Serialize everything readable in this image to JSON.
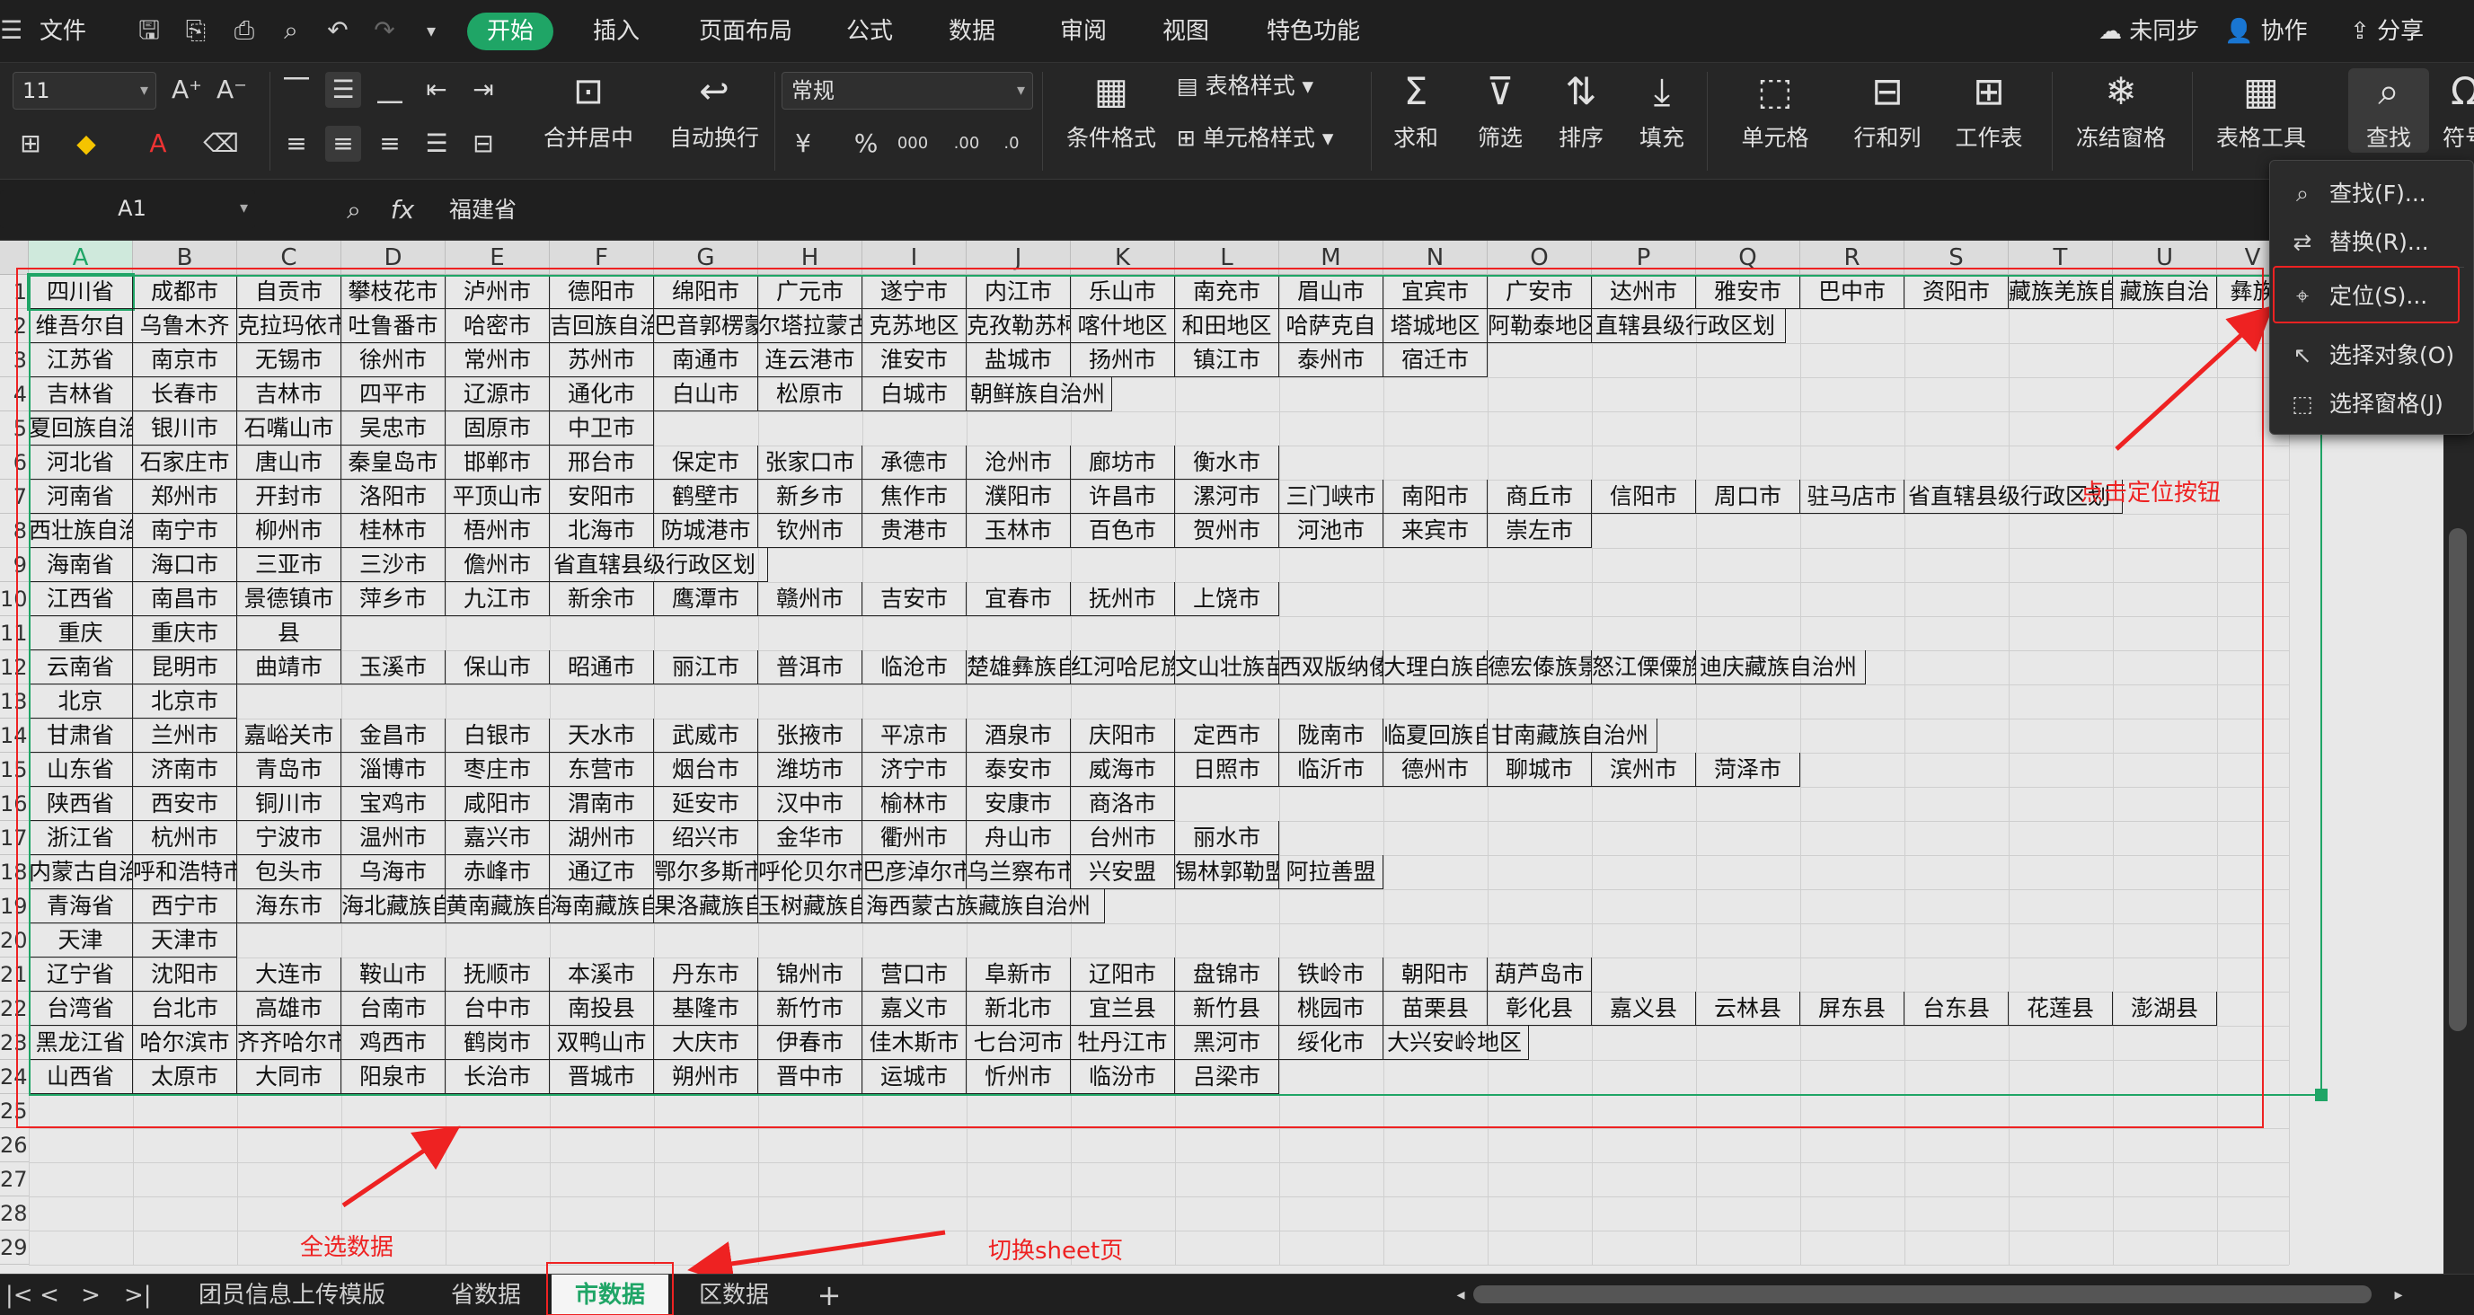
{
  "menubar": {
    "file": "文件",
    "tabs": [
      "开始",
      "插入",
      "页面布局",
      "公式",
      "数据",
      "审阅",
      "视图",
      "特色功能"
    ],
    "active_tab": "开始",
    "right": [
      "未同步",
      "协作",
      "分享"
    ]
  },
  "ribbon": {
    "font_size": "11",
    "number_format": "常规",
    "merge": "合并居中",
    "wrap": "自动换行",
    "cond_format": "条件格式",
    "table_style": "表格样式",
    "cell_style": "单元格样式",
    "sum": "求和",
    "filter": "筛选",
    "sort": "排序",
    "fill": "填充",
    "cell": "单元格",
    "rowcol": "行和列",
    "sheet": "工作表",
    "freeze": "冻结窗格",
    "table_tools": "表格工具",
    "find": "查找",
    "symbol": "符号"
  },
  "formula_bar": {
    "cell_ref": "A1",
    "fx": "fx",
    "value": "福建省"
  },
  "columns": [
    "A",
    "B",
    "C",
    "D",
    "E",
    "F",
    "G",
    "H",
    "I",
    "J",
    "K",
    "L",
    "M",
    "N",
    "O",
    "P",
    "Q",
    "R",
    "S",
    "T",
    "U",
    "V"
  ],
  "rows": [
    [
      "四川省",
      "成都市",
      "自贡市",
      "攀枝花市",
      "泸州市",
      "德阳市",
      "绵阳市",
      "广元市",
      "遂宁市",
      "内江市",
      "乐山市",
      "南充市",
      "眉山市",
      "宜宾市",
      "广安市",
      "达州市",
      "雅安市",
      "巴中市",
      "资阳市",
      "藏族羌族自",
      "藏族自治",
      "彝族"
    ],
    [
      "维吾尔自",
      "乌鲁木齐",
      "克拉玛依市",
      "吐鲁番市",
      "哈密市",
      "吉回族自治",
      "巴音郭楞蒙古自",
      "尔塔拉蒙古自",
      "克苏地区",
      "克孜勒苏柯尔克孜",
      "喀什地区",
      "和田地区",
      "哈萨克自",
      "塔城地区",
      "阿勒泰地区",
      "直辖县级行政区划"
    ],
    [
      "江苏省",
      "南京市",
      "无锡市",
      "徐州市",
      "常州市",
      "苏州市",
      "南通市",
      "连云港市",
      "淮安市",
      "盐城市",
      "扬州市",
      "镇江市",
      "泰州市",
      "宿迁市"
    ],
    [
      "吉林省",
      "长春市",
      "吉林市",
      "四平市",
      "辽源市",
      "通化市",
      "白山市",
      "松原市",
      "白城市",
      "朝鲜族自治州"
    ],
    [
      "夏回族自治",
      "银川市",
      "石嘴山市",
      "吴忠市",
      "固原市",
      "中卫市"
    ],
    [
      "河北省",
      "石家庄市",
      "唐山市",
      "秦皇岛市",
      "邯郸市",
      "邢台市",
      "保定市",
      "张家口市",
      "承德市",
      "沧州市",
      "廊坊市",
      "衡水市"
    ],
    [
      "河南省",
      "郑州市",
      "开封市",
      "洛阳市",
      "平顶山市",
      "安阳市",
      "鹤壁市",
      "新乡市",
      "焦作市",
      "濮阳市",
      "许昌市",
      "漯河市",
      "三门峡市",
      "南阳市",
      "商丘市",
      "信阳市",
      "周口市",
      "驻马店市",
      "省直辖县级行政区划"
    ],
    [
      "西壮族自治",
      "南宁市",
      "柳州市",
      "桂林市",
      "梧州市",
      "北海市",
      "防城港市",
      "钦州市",
      "贵港市",
      "玉林市",
      "百色市",
      "贺州市",
      "河池市",
      "来宾市",
      "崇左市"
    ],
    [
      "海南省",
      "海口市",
      "三亚市",
      "三沙市",
      "儋州市",
      "省直辖县级行政区划"
    ],
    [
      "江西省",
      "南昌市",
      "景德镇市",
      "萍乡市",
      "九江市",
      "新余市",
      "鹰潭市",
      "赣州市",
      "吉安市",
      "宜春市",
      "抚州市",
      "上饶市"
    ],
    [
      "重庆",
      "重庆市",
      "县"
    ],
    [
      "云南省",
      "昆明市",
      "曲靖市",
      "玉溪市",
      "保山市",
      "昭通市",
      "丽江市",
      "普洱市",
      "临沧市",
      "楚雄彝族自治",
      "红河哈尼族彝族",
      "文山壮族苗族自",
      "西双版纳傣族自",
      "大理白族自治",
      "德宏傣族景颇族",
      "怒江傈僳族自",
      "迪庆藏族自治州"
    ],
    [
      "北京",
      "北京市"
    ],
    [
      "甘肃省",
      "兰州市",
      "嘉峪关市",
      "金昌市",
      "白银市",
      "天水市",
      "武威市",
      "张掖市",
      "平凉市",
      "酒泉市",
      "庆阳市",
      "定西市",
      "陇南市",
      "临夏回族自治",
      "甘南藏族自治州"
    ],
    [
      "山东省",
      "济南市",
      "青岛市",
      "淄博市",
      "枣庄市",
      "东营市",
      "烟台市",
      "潍坊市",
      "济宁市",
      "泰安市",
      "威海市",
      "日照市",
      "临沂市",
      "德州市",
      "聊城市",
      "滨州市",
      "菏泽市"
    ],
    [
      "陕西省",
      "西安市",
      "铜川市",
      "宝鸡市",
      "咸阳市",
      "渭南市",
      "延安市",
      "汉中市",
      "榆林市",
      "安康市",
      "商洛市"
    ],
    [
      "浙江省",
      "杭州市",
      "宁波市",
      "温州市",
      "嘉兴市",
      "湖州市",
      "绍兴市",
      "金华市",
      "衢州市",
      "舟山市",
      "台州市",
      "丽水市"
    ],
    [
      "内蒙古自治",
      "呼和浩特市",
      "包头市",
      "乌海市",
      "赤峰市",
      "通辽市",
      "鄂尔多斯市",
      "呼伦贝尔市",
      "巴彦淖尔市",
      "乌兰察布市",
      "兴安盟",
      "锡林郭勒盟",
      "阿拉善盟"
    ],
    [
      "青海省",
      "西宁市",
      "海东市",
      "海北藏族自治",
      "黄南藏族自治",
      "海南藏族自治",
      "果洛藏族自治",
      "玉树藏族自治",
      "海西蒙古族藏族自治州"
    ],
    [
      "天津",
      "天津市"
    ],
    [
      "辽宁省",
      "沈阳市",
      "大连市",
      "鞍山市",
      "抚顺市",
      "本溪市",
      "丹东市",
      "锦州市",
      "营口市",
      "阜新市",
      "辽阳市",
      "盘锦市",
      "铁岭市",
      "朝阳市",
      "葫芦岛市"
    ],
    [
      "台湾省",
      "台北市",
      "高雄市",
      "台南市",
      "台中市",
      "南投县",
      "基隆市",
      "新竹市",
      "嘉义市",
      "新北市",
      "宜兰县",
      "新竹县",
      "桃园市",
      "苗栗县",
      "彰化县",
      "嘉义县",
      "云林县",
      "屏东县",
      "台东县",
      "花莲县",
      "澎湖县"
    ],
    [
      "黑龙江省",
      "哈尔滨市",
      "齐齐哈尔市",
      "鸡西市",
      "鹤岗市",
      "双鸭山市",
      "大庆市",
      "伊春市",
      "佳木斯市",
      "七台河市",
      "牡丹江市",
      "黑河市",
      "绥化市",
      "大兴安岭地区"
    ],
    [
      "山西省",
      "太原市",
      "大同市",
      "阳泉市",
      "长治市",
      "晋城市",
      "朔州市",
      "晋中市",
      "运城市",
      "忻州市",
      "临汾市",
      "吕梁市"
    ]
  ],
  "row_numbers": [
    "1",
    "2",
    "3",
    "4",
    "5",
    "6",
    "7",
    "8",
    "9",
    "10",
    "11",
    "12",
    "13",
    "14",
    "15",
    "16",
    "17",
    "18",
    "19",
    "20",
    "21",
    "22",
    "23",
    "24",
    "25",
    "26",
    "27",
    "28",
    "29"
  ],
  "find_menu": [
    {
      "icon": "search-icon",
      "label": "查找(F)..."
    },
    {
      "icon": "replace-icon",
      "label": "替换(R)..."
    },
    {
      "icon": "locate-icon",
      "label": "定位(S)..."
    },
    {
      "icon": "cursor-icon",
      "label": "选择对象(O)"
    },
    {
      "icon": "pane-icon",
      "label": "选择窗格(J)"
    }
  ],
  "sheet_tabs": [
    "团员信息上传模版",
    "省数据",
    "市数据",
    "区数据"
  ],
  "active_sheet": "市数据",
  "annotations": {
    "select_all": "全选数据",
    "switch_sheet": "切换sheet页",
    "click_locate": "点击定位按钮"
  },
  "colors": {
    "accent": "#1fa566",
    "annotation": "#e22222"
  }
}
